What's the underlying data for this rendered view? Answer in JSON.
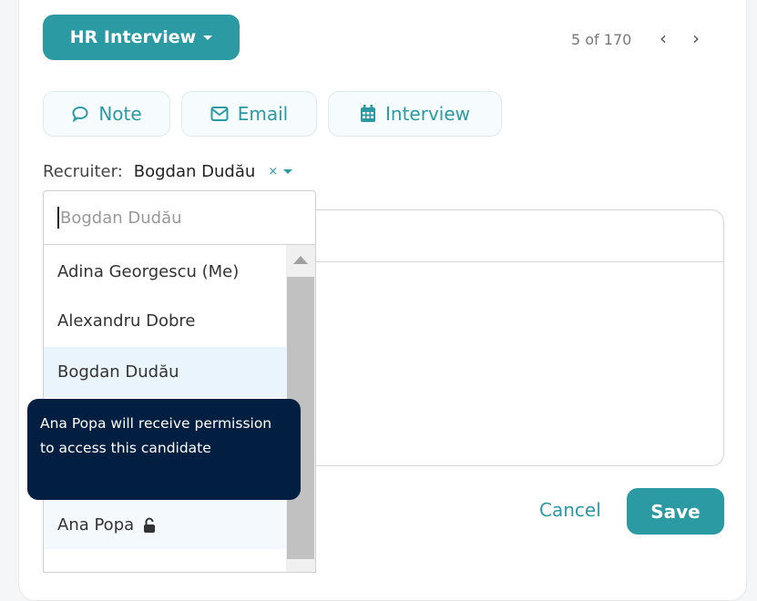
{
  "stage": {
    "label": "HR Interview"
  },
  "pager": {
    "text": "5 of 170",
    "prev": "‹",
    "next": "›"
  },
  "actions": [
    {
      "label": "Note",
      "icon": "chat-bubble-icon"
    },
    {
      "label": "Email",
      "icon": "envelope-icon"
    },
    {
      "label": "Interview",
      "icon": "calendar-icon"
    }
  ],
  "recruiter": {
    "label": "Recruiter:",
    "value": "Bogdan Dudău",
    "clear": "×"
  },
  "dropdown": {
    "placeholder": "Bogdan Dudău",
    "options": [
      "Adina Georgescu (Me)",
      "Alexandru Dobre",
      "Bogdan Dudău",
      "Ana Popa"
    ],
    "selected": "Bogdan Dudău"
  },
  "tooltip": {
    "text": "Ana Popa will receive permission to access this candidate"
  },
  "footer": {
    "cancel": "Cancel",
    "save": "Save"
  },
  "colors": {
    "accent": "#2c9aa2",
    "tooltip_bg": "#021e40",
    "highlight": "#eaf4fd"
  }
}
